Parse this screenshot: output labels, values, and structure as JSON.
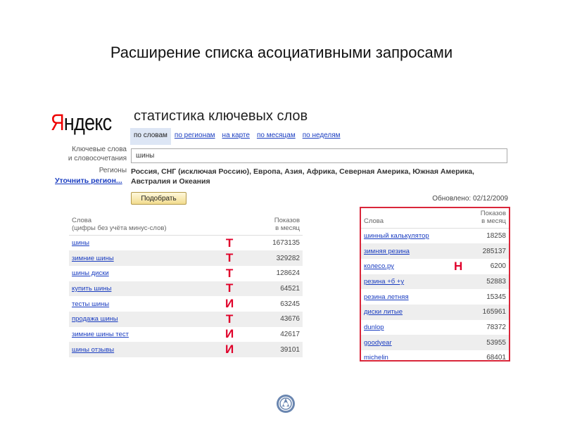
{
  "slide_title": "Расширение списка асоциативными запросами",
  "logo": {
    "first": "Я",
    "rest": "ндекс"
  },
  "page_title": "статистика ключевых слов",
  "tabs": [
    {
      "label": "по словам"
    },
    {
      "label": "по регионам"
    },
    {
      "label": "на карте"
    },
    {
      "label": "по месяцам"
    },
    {
      "label": "по неделям"
    }
  ],
  "keywords_label_1": "Ключевые слова",
  "keywords_label_2": "и словосочетания",
  "keywords_value": "шины",
  "regions_label": "Регионы",
  "regions_value": "Россия, СНГ (исключая Россию), Европа, Азия, Африка, Северная Америка, Южная Америка, Австралия и Океания",
  "refine_link": "Уточнить регион...",
  "pick_button": "Подобрать",
  "updated": "Обновлено: 02/12/2009",
  "left_table": {
    "col1": "Слова",
    "col1_sub": "(цифры без учёта минус-слов)",
    "col2": "Показов",
    "col2_sub": "в месяц",
    "rows": [
      {
        "word": "шины",
        "mark": "Т",
        "count": "1673135"
      },
      {
        "word": "зимние шины",
        "mark": "Т",
        "count": "329282"
      },
      {
        "word": "шины диски",
        "mark": "Т",
        "count": "128624"
      },
      {
        "word": "купить шины",
        "mark": "Т",
        "count": "64521"
      },
      {
        "word": "тесты шины",
        "mark": "И",
        "count": "63245"
      },
      {
        "word": "продажа шины",
        "mark": "Т",
        "count": "43676"
      },
      {
        "word": "зимние шины тест",
        "mark": "И",
        "count": "42617"
      },
      {
        "word": "шины отзывы",
        "mark": "И",
        "count": "39101"
      }
    ]
  },
  "right_table": {
    "col1": "Слова",
    "col2": "Показов",
    "col2_sub": "в месяц",
    "rows": [
      {
        "word": "шинный калькулятор",
        "mark": "",
        "count": "18258"
      },
      {
        "word": "зимняя резина",
        "mark": "",
        "count": "285137"
      },
      {
        "word": "колесо.ру",
        "mark": "Н",
        "count": "6200"
      },
      {
        "word": "резина +б +у",
        "mark": "",
        "count": "52883"
      },
      {
        "word": "резина летняя",
        "mark": "",
        "count": "15345"
      },
      {
        "word": "диски литые",
        "mark": "",
        "count": "165961"
      },
      {
        "word": "dunlop",
        "mark": "",
        "count": "78372"
      },
      {
        "word": "goodyear",
        "mark": "",
        "count": "53955"
      },
      {
        "word": "michelin",
        "mark": "",
        "count": "68401"
      }
    ]
  },
  "colors": {
    "accent_red": "#e0002a",
    "link": "#1a3dc1",
    "highlight_border": "#d9263a"
  }
}
